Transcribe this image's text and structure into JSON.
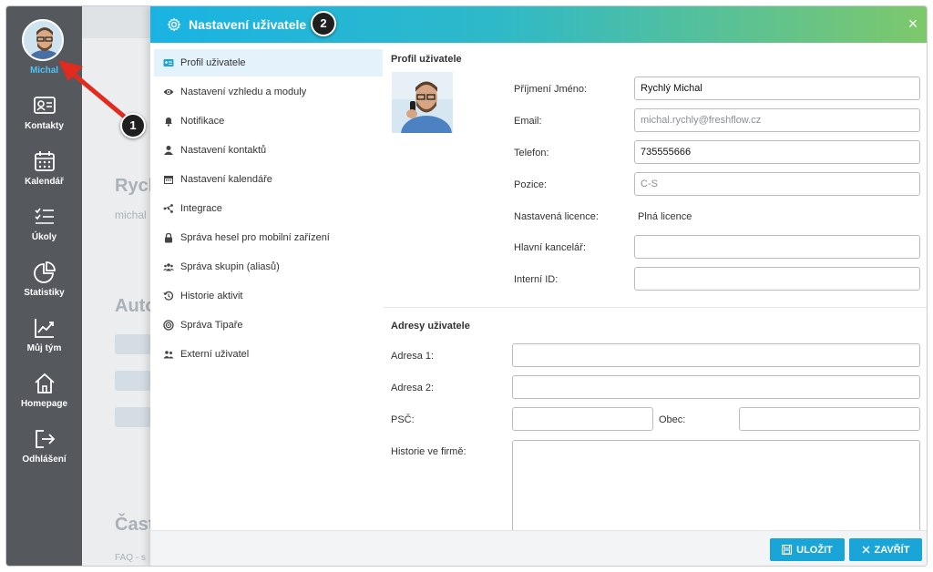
{
  "sidebar": {
    "user_name": "Michal",
    "items": [
      {
        "label": "Kontakty",
        "icon": "contacts-icon"
      },
      {
        "label": "Kalendář",
        "icon": "calendar-icon"
      },
      {
        "label": "Úkoly",
        "icon": "tasks-icon"
      },
      {
        "label": "Statistiky",
        "icon": "statistics-icon"
      },
      {
        "label": "Můj tým",
        "icon": "team-chart-icon"
      },
      {
        "label": "Homepage",
        "icon": "home-icon"
      },
      {
        "label": "Odhlášení",
        "icon": "logout-icon"
      }
    ]
  },
  "background": {
    "heading": "Rych",
    "subtext": "michal",
    "section": "Auto",
    "section2": "Čast",
    "faq": "FAQ - s"
  },
  "annotations": {
    "badge1": "1",
    "badge2": "2",
    "arrow_color": "#e02b1e"
  },
  "modal": {
    "title": "Nastavení uživatele",
    "close_label": "×",
    "header_gradient": [
      "#19b3e3",
      "#7ec86a"
    ]
  },
  "menu": {
    "items": [
      {
        "label": "Profil uživatele",
        "icon": "id-card-icon",
        "active": true
      },
      {
        "label": "Nastavení vzhledu a moduly",
        "icon": "eye-icon"
      },
      {
        "label": "Notifikace",
        "icon": "bell-icon"
      },
      {
        "label": "Nastavení kontaktů",
        "icon": "user-icon"
      },
      {
        "label": "Nastavení kalendáře",
        "icon": "calendar-icon"
      },
      {
        "label": "Integrace",
        "icon": "integration-icon"
      },
      {
        "label": "Správa hesel pro mobilní zařízení",
        "icon": "lock-icon"
      },
      {
        "label": "Správa skupin (aliasů)",
        "icon": "users-icon"
      },
      {
        "label": "Historie aktivit",
        "icon": "history-icon"
      },
      {
        "label": "Správa Tipaře",
        "icon": "target-icon"
      },
      {
        "label": "Externí uživatel",
        "icon": "external-users-icon"
      }
    ]
  },
  "profile": {
    "section_title": "Profil uživatele",
    "fields": {
      "name_label": "Příjmení Jméno:",
      "name_value": "Rychlý Michal",
      "email_label": "Email:",
      "email_value": "michal.rychly@freshflow.cz",
      "phone_label": "Telefon:",
      "phone_value": "735555666",
      "position_label": "Pozice:",
      "position_value": "C-S",
      "license_label": "Nastavená licence:",
      "license_value": "Plná licence",
      "office_label": "Hlavní kancelář:",
      "office_value": "",
      "internal_id_label": "Interní ID:",
      "internal_id_value": ""
    }
  },
  "addresses": {
    "section_title": "Adresy uživatele",
    "address1_label": "Adresa 1:",
    "address1_value": "",
    "address2_label": "Adresa 2:",
    "address2_value": "",
    "zip_label": "PSČ:",
    "zip_value": "",
    "city_label": "Obec:",
    "city_value": "",
    "history_label": "Historie ve firmě:",
    "history_value": ""
  },
  "footer": {
    "save_label": "ULOŽIT",
    "close_label": "ZAVŘÍT",
    "button_color": "#1aa5d8"
  }
}
